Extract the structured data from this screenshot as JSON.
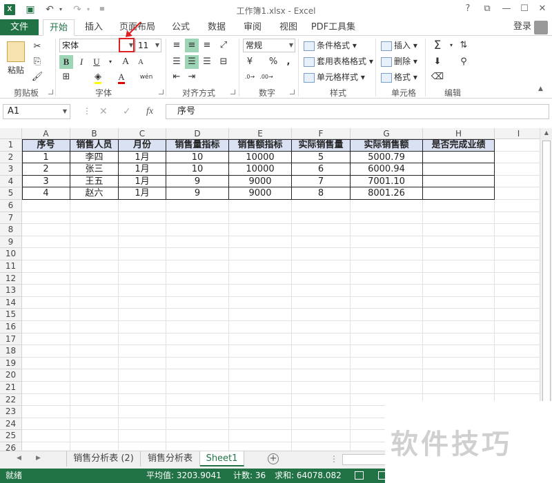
{
  "window": {
    "title": "工作簿1.xlsx - Excel",
    "controls": [
      "?",
      "⧉",
      "—",
      "☐",
      "✕"
    ]
  },
  "ribbon_tabs": {
    "file": "文件",
    "tabs": [
      "开始",
      "插入",
      "页面布局",
      "公式",
      "数据",
      "审阅",
      "视图",
      "PDF工具集"
    ],
    "active": "开始",
    "login": "登录"
  },
  "ribbon": {
    "clipboard": {
      "paste": "粘贴",
      "label": "剪贴板"
    },
    "font": {
      "name": "宋体",
      "size": "11",
      "bold": "B",
      "italic": "I",
      "underline": "U",
      "grow": "A",
      "shrink": "A",
      "wen": "wén",
      "label": "字体"
    },
    "alignment": {
      "label": "对齐方式"
    },
    "number": {
      "format": "常规",
      "percent": "%",
      "comma": ",",
      "label": "数字"
    },
    "styles": {
      "conditional": "条件格式",
      "table": "套用表格格式",
      "cell": "单元格样式",
      "label": "样式"
    },
    "cells": {
      "insert": "插入",
      "delete": "删除",
      "format": "格式",
      "label": "单元格"
    },
    "editing": {
      "sum": "Σ",
      "label": "编辑"
    }
  },
  "formula_bar": {
    "name_box": "A1",
    "fx": "fx",
    "content": "序号"
  },
  "columns": [
    "A",
    "B",
    "C",
    "D",
    "E",
    "F",
    "G",
    "H",
    "I"
  ],
  "rows": [
    "1",
    "2",
    "3",
    "4",
    "5",
    "6",
    "7",
    "8",
    "9",
    "10",
    "11",
    "12",
    "13",
    "14",
    "15",
    "16",
    "17",
    "18",
    "19",
    "20",
    "21",
    "22",
    "23",
    "24",
    "25",
    "26"
  ],
  "table": {
    "headers": [
      "序号",
      "销售人员",
      "月份",
      "销售量指标",
      "销售额指标",
      "实际销售量",
      "实际销售额",
      "是否完成业绩"
    ],
    "rows": [
      [
        "1",
        "李四",
        "1月",
        "10",
        "10000",
        "5",
        "5000.79",
        ""
      ],
      [
        "2",
        "张三",
        "1月",
        "10",
        "10000",
        "6",
        "6000.94",
        ""
      ],
      [
        "3",
        "王五",
        "1月",
        "9",
        "9000",
        "7",
        "7001.10",
        ""
      ],
      [
        "4",
        "赵六",
        "1月",
        "9",
        "9000",
        "8",
        "8001.26",
        ""
      ]
    ]
  },
  "sheets": {
    "tabs": [
      "销售分析表 (2)",
      "销售分析表",
      "Sheet1"
    ],
    "active": "Sheet1"
  },
  "status": {
    "ready": "就绪",
    "average": "平均值: 3203.9041",
    "count": "计数: 36",
    "sum": "求和: 64078.082"
  },
  "watermark": "软件技巧",
  "colors": {
    "excel_green": "#217346",
    "header_fill": "#d9e1f2",
    "highlight": "#9fd5b7",
    "annotation_red": "#e02020"
  }
}
